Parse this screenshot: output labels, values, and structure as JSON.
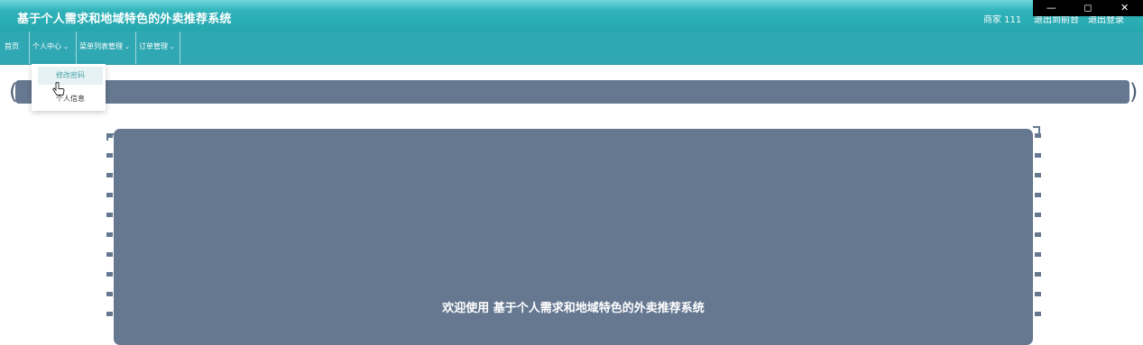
{
  "header": {
    "app_title": "基于个人需求和地域特色的外卖推荐系统",
    "user_label": "商家 111",
    "link_front": "退出到前台",
    "link_logout": "退出登录",
    "colors": {
      "gradient_top": "#6fd7dc",
      "gradient_bottom": "#25a7ae"
    }
  },
  "window_controls": {
    "minimize": "—",
    "restore": "◻",
    "close": "✕"
  },
  "nav": {
    "home": "首页",
    "personal": "个人中心",
    "menu_list": "菜单列表管理",
    "order": "订单管理",
    "chevron": "⌄",
    "color": "#30a8b4"
  },
  "dropdown": {
    "items": [
      "修改密码",
      "个人信息"
    ]
  },
  "breadcrumb": {
    "color": "#657890"
  },
  "welcome": {
    "text": "欢迎使用 基于个人需求和地域特色的外卖推荐系统",
    "color": "#657890"
  }
}
